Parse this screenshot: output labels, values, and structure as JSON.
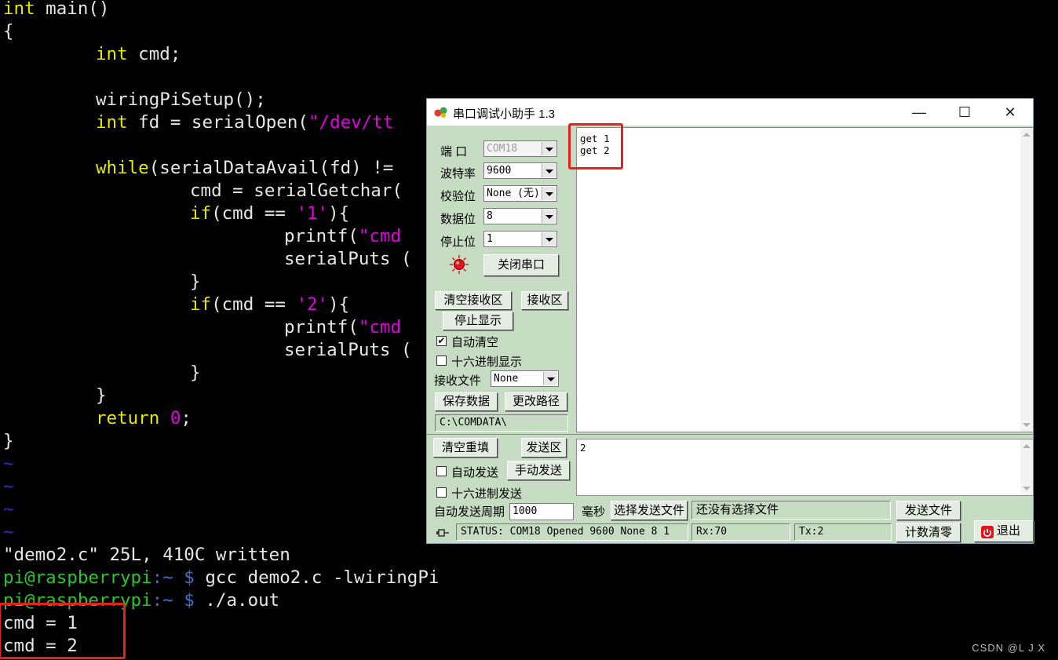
{
  "terminal": {
    "code": {
      "l1_type": "int",
      "l1_rest": " main()",
      "l2": "{",
      "l3_type": "int",
      "l3_rest": " cmd;",
      "l5": "wiringPiSetup();",
      "l6_type": "int",
      "l6_mid": " fd = serialOpen(",
      "l6_str": "\"/dev/tt",
      "l8_kw": "while",
      "l8_rest": "(serialDataAvail(fd) !=",
      "l9": "cmd = serialGetchar(",
      "l10_kw": "if",
      "l10_mid": "(cmd == ",
      "l10_str": "'1'",
      "l10_end": "){",
      "l11_fn": "printf(",
      "l11_str": "\"cmd",
      "l12": "serialPuts (",
      "l13": "}",
      "l14_kw": "if",
      "l14_mid": "(cmd == ",
      "l14_str": "'2'",
      "l14_end": "){",
      "l15_fn": "printf(",
      "l15_str": "\"cmd",
      "l16": "serialPuts (",
      "l17": "}",
      "l18": "}",
      "l19_kw": "return",
      "l19_sp": " ",
      "l19_num": "0",
      "l19_end": ";",
      "l20": "}",
      "tilde": "~"
    },
    "written_msg": "\"demo2.c\" 25L, 410C written",
    "prompt_user": "pi@raspberrypi",
    "prompt_sep": ":~ $ ",
    "cmd1": "gcc demo2.c -lwiringPi",
    "cmd2": "./a.out",
    "out1": "cmd = 1",
    "out2": "cmd = 2"
  },
  "watermark": "CSDN @L  J  X",
  "app": {
    "title": "串口调试小助手 1.3",
    "minimize": "—",
    "maximize": "☐",
    "close": "✕",
    "port_label": "端  口",
    "port_value": "COM18",
    "baud_label": "波特率",
    "baud_value": "9600",
    "parity_label": "校验位",
    "parity_value": "None (无)",
    "databits_label": "数据位",
    "databits_value": "8",
    "stopbits_label": "停止位",
    "stopbits_value": "1",
    "close_port_btn": "关闭串口",
    "clear_recv_btn": "清空接收区",
    "recv_area_label": "接收区",
    "stop_display_btn": "停止显示",
    "auto_clear_label": "自动清空",
    "auto_clear_checked": "✔",
    "hex_display_label": "十六进制显示",
    "recv_file_label": "接收文件",
    "recv_file_value": "None",
    "save_data_btn": "保存数据",
    "change_path_btn": "更改路径",
    "path_value": "C:\\COMDATA\\",
    "recv_text": "get 1\nget 2",
    "clear_refill_btn": "清空重填",
    "send_area_label": "发送区",
    "send_text": "2",
    "auto_send_label": "自动发送",
    "manual_send_btn": "手动发送",
    "hex_send_label": "十六进制发送",
    "auto_period_label": "自动发送周期",
    "period_value": "1000",
    "ms_label": "毫秒",
    "choose_file_btn": "选择发送文件",
    "no_file_text": "还没有选择文件",
    "send_file_btn": "发送文件",
    "status_text": "STATUS: COM18 Opened 9600 None  8 1",
    "rx_text": "Rx:70",
    "tx_text": "Tx:2",
    "reset_count_btn": "计数清零",
    "exit_btn": "退出",
    "accent_led": "#e0141a"
  }
}
